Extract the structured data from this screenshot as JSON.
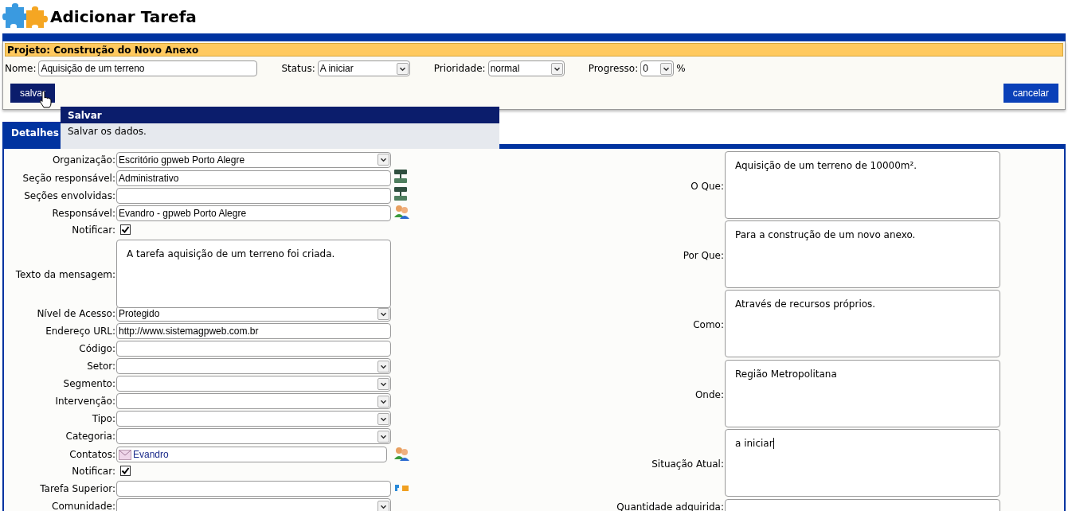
{
  "header": {
    "title": "Adicionar Tarefa"
  },
  "project": {
    "label": "Projeto: Construção do Novo Anexo"
  },
  "task": {
    "name": {
      "label": "Nome:",
      "value": "Aquisição de um terreno"
    },
    "status": {
      "label": "Status:",
      "value": "A iniciar"
    },
    "priority": {
      "label": "Prioridade:",
      "value": "normal"
    },
    "progress": {
      "label": "Progresso:",
      "value": "0",
      "unit": "%"
    }
  },
  "buttons": {
    "save": "salvar",
    "cancel": "cancelar"
  },
  "tooltip": {
    "title": "Salvar",
    "text": "Salvar os dados."
  },
  "tabs": [
    {
      "label": "Detalhes",
      "selected": true
    }
  ],
  "left_fields": [
    {
      "label": "Organização:",
      "kind": "select",
      "value": "Escritório gpweb Porto Alegre"
    },
    {
      "label": "Seção responsável:",
      "kind": "text",
      "value": "Administrativo",
      "picker": {
        "kind": "section"
      }
    },
    {
      "label": "Seções envolvidas:",
      "kind": "text",
      "picker": {
        "kind": "section"
      }
    },
    {
      "label": "Responsável:",
      "kind": "text",
      "value": "Evandro - gpweb Porto Alegre",
      "picker": {
        "kind": "user"
      }
    },
    {
      "label": "Notificar:",
      "kind": "checkbox",
      "checked": true
    },
    {
      "label": "Texto da mensagem:",
      "kind": "textarea",
      "value": "A tarefa aquisição de um terreno foi criada."
    },
    {
      "label": "Nível de Acesso:",
      "kind": "select",
      "value": "Protegido"
    },
    {
      "label": "Endereço URL:",
      "kind": "text",
      "value": "http://www.sistemagpweb.com.br"
    },
    {
      "label": "Código:",
      "kind": "text"
    },
    {
      "label": "Setor:",
      "kind": "select"
    },
    {
      "label": "Segmento:",
      "kind": "select"
    },
    {
      "label": "Intervenção:",
      "kind": "select"
    },
    {
      "label": "Tipo:",
      "kind": "select"
    },
    {
      "label": "Categoria:",
      "kind": "select"
    },
    {
      "label": "Contatos:",
      "kind": "contacts",
      "value": "Evandro",
      "picker": {
        "kind": "user"
      }
    },
    {
      "label": "Notificar:",
      "kind": "checkbox",
      "checked": true
    },
    {
      "label": "Tarefa Superior:",
      "kind": "text",
      "picker": {
        "kind": "task"
      }
    },
    {
      "label": "Comunidade:",
      "kind": "select"
    }
  ],
  "right_fields": [
    {
      "label": "O Que:",
      "kind": "textarea",
      "value": "Aquisição de um terreno de 10000m²."
    },
    {
      "label": "Por Que:",
      "kind": "textarea",
      "value": "Para a construção de um novo anexo."
    },
    {
      "label": "Como:",
      "kind": "textarea",
      "value": "Através de recursos próprios."
    },
    {
      "label": "Onde:",
      "kind": "textarea",
      "value": "Região Metropolitana"
    },
    {
      "label": "Situação Atual:",
      "kind": "textarea",
      "value": "a iniciar",
      "focused": true
    },
    {
      "label": "Quantidade adquirida:",
      "kind": "text"
    }
  ]
}
